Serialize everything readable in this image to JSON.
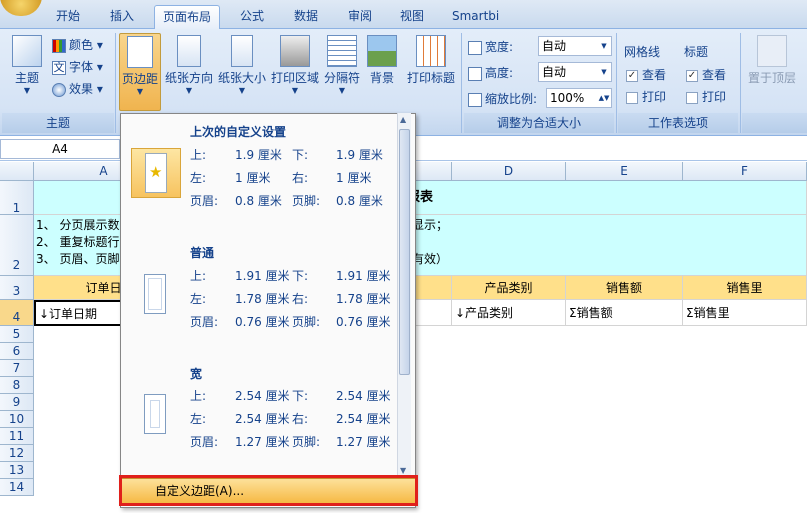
{
  "tabs": [
    "开始",
    "插入",
    "页面布局",
    "公式",
    "数据",
    "审阅",
    "视图",
    "Smartbi"
  ],
  "active_tab": "页面布局",
  "ribbon": {
    "theme_group": {
      "label": "主题",
      "theme_btn": "主题",
      "colors": "颜色",
      "fonts": "字体",
      "effects": "效果"
    },
    "page_setup": {
      "margins": "页边距",
      "orientation": "纸张方向",
      "size": "纸张大小",
      "print_area": "打印区域",
      "breaks": "分隔符",
      "background": "背景",
      "print_titles": "打印标题"
    },
    "scale": {
      "label": "调整为合适大小",
      "width_label": "宽度:",
      "width_val": "自动",
      "height_label": "高度:",
      "height_val": "自动",
      "scale_label": "缩放比例:",
      "scale_val": "100%"
    },
    "sheet_options": {
      "label": "工作表选项",
      "gridlines": "网格线",
      "headings": "标题",
      "view": "查看",
      "print": "打印"
    },
    "arrange": {
      "bring_front": "置于顶层"
    }
  },
  "namebox": "A4",
  "columns": [
    "A",
    "D",
    "E",
    "F"
  ],
  "rows": [
    "1",
    "2",
    "3",
    "4",
    "5",
    "6",
    "7",
    "8",
    "9",
    "10",
    "11",
    "12",
    "13",
    "14"
  ],
  "cells": {
    "r1_title": "页报表",
    "r2_line1": "1、  分页展示数",
    "r2_line2": "2、  重复标题行",
    "r2_line3": "3、  页眉、页脚",
    "r2_right1": "显示；",
    "r2_right2": "有效）",
    "r3_a": "订单日",
    "r3_d": "产品类别",
    "r3_e": "销售额",
    "r3_f": "销售里",
    "r4_a": "↓订单日期",
    "r4_d": "↓产品类别",
    "r4_e": "Σ销售额",
    "r4_f": "Σ销售里"
  },
  "margins_menu": {
    "last_custom": {
      "title": "上次的自定义设置",
      "top": "1.9 厘米",
      "bottom": "1.9 厘米",
      "left": "1 厘米",
      "right": "1 厘米",
      "header": "0.8 厘米",
      "footer": "0.8 厘米"
    },
    "normal": {
      "title": "普通",
      "top": "1.91 厘米",
      "bottom": "1.91 厘米",
      "left": "1.78 厘米",
      "right": "1.78 厘米",
      "header": "0.76 厘米",
      "footer": "0.76 厘米"
    },
    "wide": {
      "title": "宽",
      "top": "2.54 厘米",
      "bottom": "2.54 厘米",
      "left": "2.54 厘米",
      "right": "2.54 厘米",
      "header": "1.27 厘米",
      "footer": "1.27 厘米"
    },
    "labels": {
      "top": "上:",
      "bottom": "下:",
      "left": "左:",
      "right": "右:",
      "header": "页眉:",
      "footer": "页脚:"
    },
    "custom_margins": "自定义边距(A)..."
  }
}
